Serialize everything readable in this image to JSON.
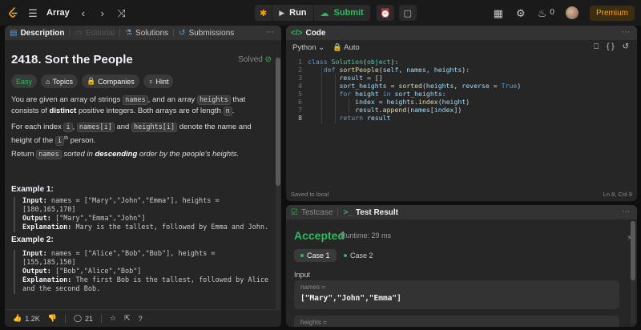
{
  "topbar": {
    "title": "Array",
    "run_label": "Run",
    "submit_label": "Submit",
    "streak_count": "0",
    "premium_label": "Premium"
  },
  "description_tabs": [
    "Description",
    "Editorial",
    "Solutions",
    "Submissions"
  ],
  "problem": {
    "title": "2418. Sort the People",
    "solved_label": "Solved",
    "chips": [
      "Easy",
      "Topics",
      "Companies",
      "Hint"
    ],
    "para1_a": "You are given an array of strings ",
    "para1_code1": "names",
    "para1_b": ", and an array ",
    "para1_code2": "heights",
    "para1_c": " that consists of ",
    "para1_bold": "distinct",
    "para1_d": " positive integers. Both arrays are of length ",
    "para1_code3": "n",
    "para1_e": ".",
    "para2_a": "For each index ",
    "para2_code1": "i",
    "para2_b": ", ",
    "para2_code2": "names[i]",
    "para2_c": " and ",
    "para2_code3": "heights[i]",
    "para2_d": " denote the name and height of the ",
    "para2_code4": "i",
    "para2_sup": "th",
    "para2_e": " person.",
    "para3_a": "Return ",
    "para3_code": "names",
    "para3_b": " sorted in ",
    "para3_bold": "descending",
    "para3_c": " order by the people's heights."
  },
  "examples": [
    {
      "title": "Example 1:",
      "input_label": "Input:",
      "input": "names = [\"Mary\",\"John\",\"Emma\"], heights = [180,165,170]",
      "output_label": "Output:",
      "output": "[\"Mary\",\"Emma\",\"John\"]",
      "explanation_label": "Explanation:",
      "explanation_l1": "Mary is the tallest, followed by Emma and John.",
      "explanation_l2": ""
    },
    {
      "title": "Example 2:",
      "input_label": "Input:",
      "input": "names = [\"Alice\",\"Bob\",\"Bob\"], heights = [155,185,150]",
      "output_label": "Output:",
      "output": "[\"Bob\",\"Alice\",\"Bob\"]",
      "explanation_label": "Explanation:",
      "explanation_l1": "The first Bob is the tallest, followed by Alice",
      "explanation_l2": "and the second Bob."
    }
  ],
  "footer": {
    "likes": "1.2K",
    "comments": "21"
  },
  "code": {
    "tab_label": "Code",
    "language": "Python",
    "auto_label": "Auto",
    "saved_label": "Saved to local",
    "cursor_pos": "Ln 8, Col 9",
    "lines": [
      {
        "n": "1",
        "t": "class Solution(object):"
      },
      {
        "n": "2",
        "t": "    def sortPeople(self, names, heights):"
      },
      {
        "n": "3",
        "t": "        result = []"
      },
      {
        "n": "4",
        "t": "        sort_heights = sorted(heights, reverse = True)"
      },
      {
        "n": "5",
        "t": "        for height in sort_heights:"
      },
      {
        "n": "6",
        "t": "            index = heights.index(height)"
      },
      {
        "n": "7",
        "t": "            result.append(names[index])"
      },
      {
        "n": "8",
        "t": "        return result"
      }
    ]
  },
  "test": {
    "tabs": [
      "Testcase",
      "Test Result"
    ],
    "status": "Accepted",
    "runtime": "Runtime: 29 ms",
    "cases": [
      "Case 1",
      "Case 2"
    ],
    "input_label": "Input",
    "inputs": [
      {
        "key": "names =",
        "value": "[\"Mary\",\"John\",\"Emma\"]"
      },
      {
        "key": "heights =",
        "value": ""
      }
    ]
  },
  "colors": {
    "accent_orange": "#ffa116",
    "success_green": "#2cbb5d",
    "link_blue": "#569cd6"
  }
}
